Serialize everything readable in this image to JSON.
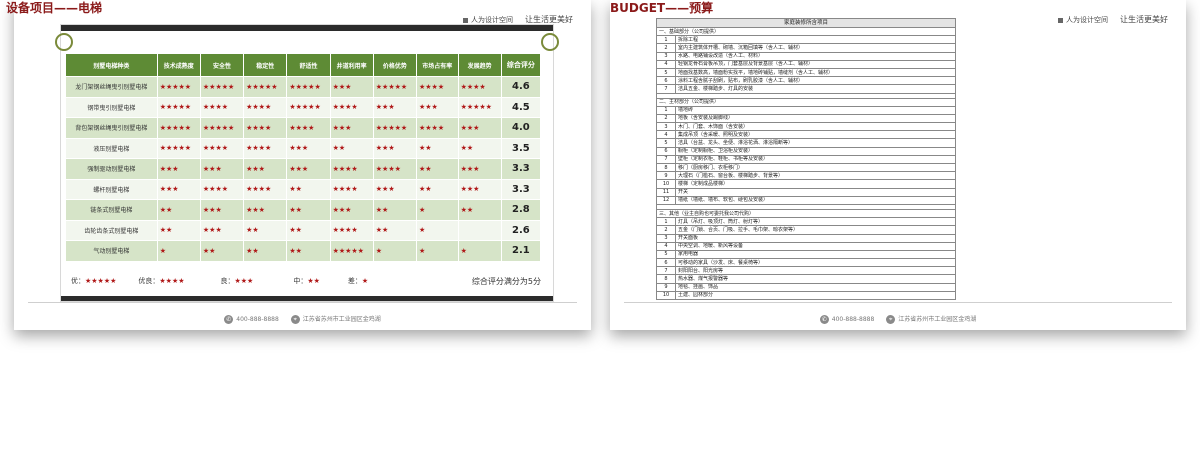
{
  "left": {
    "title": "设备项目——电梯",
    "brand": {
      "company": "人为设计空间",
      "slogan": "让生活更美好"
    },
    "table": {
      "headers": [
        "别墅电梯种类",
        "技术成熟度",
        "安全性",
        "稳定性",
        "舒适性",
        "井道利用率",
        "价格优势",
        "市场占有率",
        "发展趋势",
        "综合评分"
      ],
      "rows": [
        {
          "name": "龙门架钢丝绳曳引别墅电梯",
          "stars": [
            "★★★★★",
            "★★★★★",
            "★★★★★",
            "★★★★★",
            "★★★",
            "★★★★★",
            "★★★★",
            "★★★★"
          ],
          "score": "4.6"
        },
        {
          "name": "钢带曳引别墅电梯",
          "stars": [
            "★★★★★",
            "★★★★",
            "★★★★",
            "★★★★★",
            "★★★★",
            "★★★",
            "★★★",
            "★★★★★"
          ],
          "score": "4.5"
        },
        {
          "name": "背包架钢丝绳曳引别墅电梯",
          "stars": [
            "★★★★★",
            "★★★★★",
            "★★★★",
            "★★★★",
            "★★★",
            "★★★★★",
            "★★★★",
            "★★★"
          ],
          "score": "4.0"
        },
        {
          "name": "液压别墅电梯",
          "stars": [
            "★★★★★",
            "★★★★",
            "★★★★",
            "★★★",
            "★★",
            "★★★",
            "★★",
            "★★"
          ],
          "score": "3.5"
        },
        {
          "name": "强制驱动别墅电梯",
          "stars": [
            "★★★",
            "★★★",
            "★★★",
            "★★★",
            "★★★★",
            "★★★★",
            "★★",
            "★★★"
          ],
          "score": "3.3"
        },
        {
          "name": "螺杆别墅电梯",
          "stars": [
            "★★★",
            "★★★★",
            "★★★★",
            "★★",
            "★★★★",
            "★★★",
            "★★",
            "★★★"
          ],
          "score": "3.3"
        },
        {
          "name": "链条式别墅电梯",
          "stars": [
            "★★",
            "★★★",
            "★★★",
            "★★",
            "★★★",
            "★★",
            "★",
            "★★"
          ],
          "score": "2.8"
        },
        {
          "name": "齿轮齿条式别墅电梯",
          "stars": [
            "★★",
            "★★★",
            "★★",
            "★★",
            "★★★★",
            "★★",
            "★",
            ""
          ],
          "score": "2.6"
        },
        {
          "name": "气动别墅电梯",
          "stars": [
            "★",
            "★★",
            "★★",
            "★★",
            "★★★★★",
            "★",
            "★",
            "★"
          ],
          "score": "2.1"
        }
      ]
    },
    "legend": [
      {
        "label": "优：",
        "stars": "★★★★★"
      },
      {
        "label": "优良：",
        "stars": "★★★★"
      },
      {
        "label": "良：",
        "stars": "★★★"
      },
      {
        "label": "中：",
        "stars": "★★"
      },
      {
        "label": "差：",
        "stars": "★"
      }
    ],
    "legend_note": "综合评分满分为5分",
    "footer": {
      "phone": "400-888-8888",
      "address": "江苏省苏州市工业园区金鸡湖"
    }
  },
  "right": {
    "title": "BUDGET——预算",
    "brand": {
      "company": "人为设计空间",
      "slogan": "让生活更美好"
    },
    "budget_header": "家庭装修所含项目",
    "sections": [
      {
        "title": "一、基础部分（公司提供）",
        "items": [
          {
            "n": "1",
            "text": "拆除工程"
          },
          {
            "n": "2",
            "text": "室内主建筑体开槽、砌墙、沉箱回填等（含人工、辅材）"
          },
          {
            "n": "3",
            "text": "水路、电路铺设改造（含人工、材料）"
          },
          {
            "n": "4",
            "text": "轻钢龙骨石膏板吊顶，门套基层及背景基层（含人工、辅材）"
          },
          {
            "n": "5",
            "text": "地面找基数高，墙面粉实找平，墙地砖铺贴，墙缝剂（含人工、辅材）"
          },
          {
            "n": "6",
            "text": "涂料工程含腻子刮刷，贴布，刷乳胶漆（含人工、辅材）"
          },
          {
            "n": "7",
            "text": "洁具五金、楼梯踏步、灯具的安装"
          }
        ]
      },
      {
        "title": "二、主材部分（公司提供）",
        "items": [
          {
            "n": "1",
            "text": "墙地砖"
          },
          {
            "n": "2",
            "text": "地板（含安装及踢脚线）"
          },
          {
            "n": "3",
            "text": "木门、门套、木饰面（含安装）"
          },
          {
            "n": "4",
            "text": "集成吊顶（含采暖、照明及安装）"
          },
          {
            "n": "5",
            "text": "洁具（台盆、龙头、坐便、淋浴花洒、淋浴隔断等）"
          },
          {
            "n": "6",
            "text": "橱柜（定制橱柜、卫浴柜及安装）"
          },
          {
            "n": "7",
            "text": "壁柜（定制衣柜、鞋柜、书柜等及安装）"
          },
          {
            "n": "8",
            "text": "移门（厨房移门、衣柜移门）"
          },
          {
            "n": "9",
            "text": "大理石（门槛石、窗台板、楼梯踏步、背景等）"
          },
          {
            "n": "10",
            "text": "楼梯（定制成品楼梯）"
          },
          {
            "n": "11",
            "text": "开关"
          },
          {
            "n": "12",
            "text": "墙纸（墙纸、墙布、软包、硬包及安装）"
          }
        ]
      },
      {
        "title": "三、其他（业主自购也可委托我公司代购）",
        "items": [
          {
            "n": "1",
            "text": "灯具（吊灯、吸顶灯、筒灯、射灯等）"
          },
          {
            "n": "2",
            "text": "五金（门锁、合页、门吸、拉手、毛巾架、晾衣架等）"
          },
          {
            "n": "3",
            "text": "开关面板"
          },
          {
            "n": "4",
            "text": "中央空调、地暖、新风等设备"
          },
          {
            "n": "5",
            "text": "家用电器"
          },
          {
            "n": "6",
            "text": "可移动的家具（沙发、床、餐桌椅等）"
          },
          {
            "n": "7",
            "text": "封阳阳台、阳光房等"
          },
          {
            "n": "8",
            "text": "热水器、煤气报警器等"
          },
          {
            "n": "9",
            "text": "地毯、挂画、饰品"
          },
          {
            "n": "10",
            "text": "土建、园林部分"
          }
        ]
      }
    ],
    "footer": {
      "phone": "400-888-8888",
      "address": "江苏省苏州市工业园区金鸡湖"
    }
  }
}
